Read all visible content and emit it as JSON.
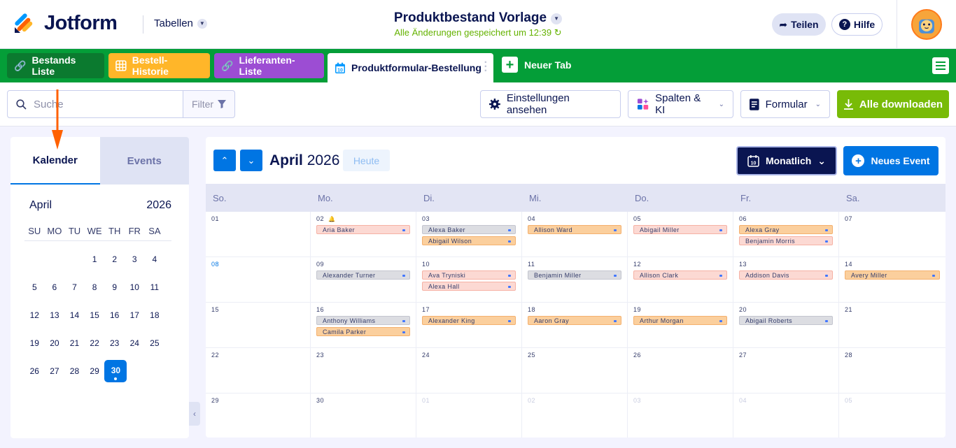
{
  "header": {
    "brand": "Jotform",
    "tables_label": "Tabellen",
    "form_title": "Produktbestand Vorlage",
    "saved_status": "Alle Änderungen gespeichert um 12:39",
    "share_label": "Teilen",
    "help_label": "Hilfe"
  },
  "tabs": [
    {
      "label": "Bestands Liste",
      "icon": "link-icon"
    },
    {
      "label": "Bestell-Historie",
      "icon": "table-icon"
    },
    {
      "label": "Lieferanten-Liste",
      "icon": "link-icon"
    },
    {
      "label": "Produktformular-Bestellung",
      "icon": "calendar-icon"
    }
  ],
  "new_tab_label": "Neuer Tab",
  "toolbar": {
    "search_placeholder": "Suche",
    "filter_label": "Filter",
    "settings_label": "Einstellungen ansehen",
    "columns_label": "Spalten & KI",
    "form_label": "Formular",
    "download_label": "Alle downloaden"
  },
  "sidebar": {
    "tab_calendar": "Kalender",
    "tab_events": "Events",
    "month": "April",
    "year": "2026",
    "weekdays": [
      "SU",
      "MO",
      "TU",
      "WE",
      "TH",
      "FR",
      "SA"
    ],
    "weeks": [
      [
        "",
        "",
        "",
        "1",
        "2",
        "3",
        "4"
      ],
      [
        "5",
        "6",
        "7",
        "8",
        "9",
        "10",
        "11"
      ],
      [
        "12",
        "13",
        "14",
        "15",
        "16",
        "17",
        "18"
      ],
      [
        "19",
        "20",
        "21",
        "22",
        "23",
        "24",
        "25"
      ],
      [
        "26",
        "27",
        "28",
        "29",
        "30",
        "",
        ""
      ]
    ],
    "selected_day": "30"
  },
  "calendar": {
    "month": "April",
    "year": "2026",
    "today_label": "Heute",
    "view_label": "Monatlich",
    "new_event_label": "Neues Event",
    "weekdays": [
      "So.",
      "Mo.",
      "Di.",
      "Mi.",
      "Do.",
      "Fr.",
      "Sa."
    ],
    "weeks": [
      [
        {
          "day": "01",
          "events": []
        },
        {
          "day": "02",
          "bell": true,
          "events": [
            {
              "name": "Aria Baker",
              "color": "pink"
            }
          ]
        },
        {
          "day": "03",
          "events": [
            {
              "name": "Alexa Baker",
              "color": "gray"
            },
            {
              "name": "Abigail Wilson",
              "color": "orange"
            }
          ]
        },
        {
          "day": "04",
          "events": [
            {
              "name": "Allison Ward",
              "color": "orange"
            }
          ]
        },
        {
          "day": "05",
          "events": [
            {
              "name": "Abigail Miller",
              "color": "pink"
            }
          ]
        },
        {
          "day": "06",
          "events": [
            {
              "name": "Alexa Gray",
              "color": "orange"
            },
            {
              "name": "Benjamin Morris",
              "color": "pink"
            }
          ]
        },
        {
          "day": "07",
          "events": []
        }
      ],
      [
        {
          "day": "08",
          "highlight": true,
          "events": []
        },
        {
          "day": "09",
          "events": [
            {
              "name": "Alexander Turner",
              "color": "gray"
            }
          ]
        },
        {
          "day": "10",
          "events": [
            {
              "name": "Ava Tryniski",
              "color": "pink"
            },
            {
              "name": "Alexa Hall",
              "color": "pink"
            }
          ]
        },
        {
          "day": "11",
          "events": [
            {
              "name": "Benjamin Miller",
              "color": "gray"
            }
          ]
        },
        {
          "day": "12",
          "events": [
            {
              "name": "Allison Clark",
              "color": "pink"
            }
          ]
        },
        {
          "day": "13",
          "events": [
            {
              "name": "Addison Davis",
              "color": "pink"
            }
          ]
        },
        {
          "day": "14",
          "events": [
            {
              "name": "Avery Miller",
              "color": "orange"
            }
          ]
        }
      ],
      [
        {
          "day": "15",
          "events": []
        },
        {
          "day": "16",
          "events": [
            {
              "name": "Anthony Williams",
              "color": "gray"
            },
            {
              "name": "Camila Parker",
              "color": "orange"
            }
          ]
        },
        {
          "day": "17",
          "events": [
            {
              "name": "Alexander King",
              "color": "orange"
            }
          ]
        },
        {
          "day": "18",
          "events": [
            {
              "name": "Aaron Gray",
              "color": "orange"
            }
          ]
        },
        {
          "day": "19",
          "events": [
            {
              "name": "Arthur Morgan",
              "color": "orange"
            }
          ]
        },
        {
          "day": "20",
          "events": [
            {
              "name": "Abigail Roberts",
              "color": "gray"
            }
          ]
        },
        {
          "day": "21",
          "events": []
        }
      ],
      [
        {
          "day": "22",
          "events": []
        },
        {
          "day": "23",
          "events": []
        },
        {
          "day": "24",
          "events": []
        },
        {
          "day": "25",
          "events": []
        },
        {
          "day": "26",
          "events": []
        },
        {
          "day": "27",
          "events": []
        },
        {
          "day": "28",
          "events": []
        }
      ],
      [
        {
          "day": "29",
          "events": []
        },
        {
          "day": "30",
          "events": []
        },
        {
          "day": "01",
          "faded": true,
          "events": []
        },
        {
          "day": "02",
          "faded": true,
          "events": []
        },
        {
          "day": "03",
          "faded": true,
          "events": []
        },
        {
          "day": "04",
          "faded": true,
          "events": []
        },
        {
          "day": "05",
          "faded": true,
          "events": []
        }
      ]
    ]
  },
  "colors": {
    "brand_green": "#049e38",
    "primary_blue": "#0075e3",
    "navy": "#0a1551",
    "download_green": "#78bb07",
    "annotation_arrow": "#ff6100"
  }
}
